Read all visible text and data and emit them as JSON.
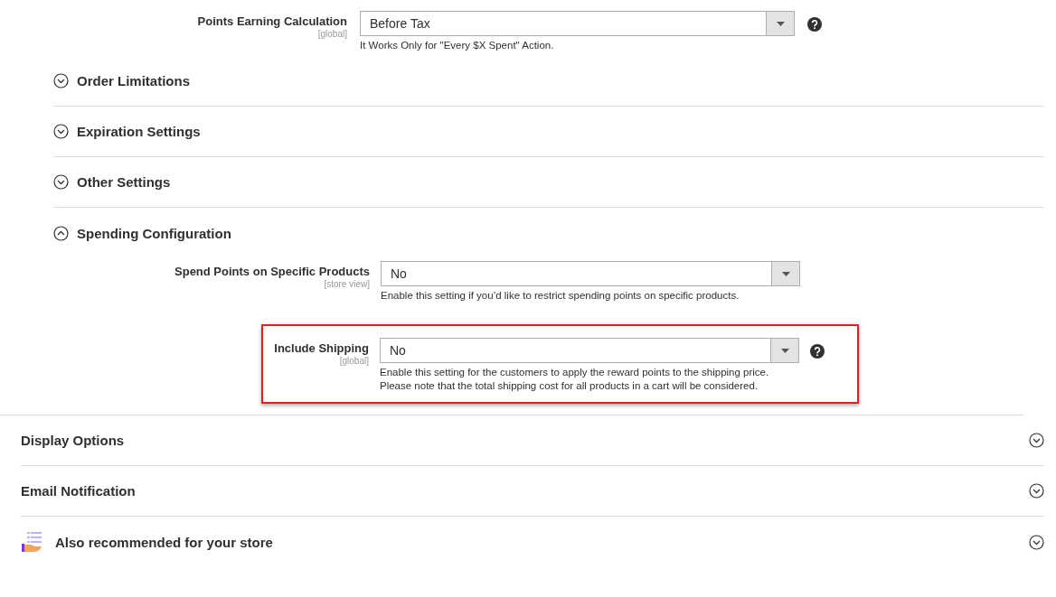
{
  "top_field": {
    "label": "Points Earning Calculation",
    "scope": "[global]",
    "value": "Before Tax",
    "note": "It Works Only for \"Every $X Spent\" Action.",
    "help": true
  },
  "subsections": [
    {
      "title": "Order Limitations",
      "expanded": false
    },
    {
      "title": "Expiration Settings",
      "expanded": false
    },
    {
      "title": "Other Settings",
      "expanded": false
    },
    {
      "title": "Spending Configuration",
      "expanded": true
    }
  ],
  "spending_fields": [
    {
      "label": "Spend Points on Specific Products",
      "scope": "[store view]",
      "value": "No",
      "note": "Enable this setting if you’d like to restrict spending points on specific products.",
      "help": false,
      "highlighted": false
    },
    {
      "label": "Include Shipping",
      "scope": "[global]",
      "value": "No",
      "note": "Enable this setting for the customers to apply the reward points to the shipping price. Please note that the total shipping cost for all products in a cart will be considered.",
      "help": true,
      "highlighted": true
    }
  ],
  "sections": [
    {
      "title": "Display Options",
      "kind": "plain",
      "expanded": false
    },
    {
      "title": "Email Notification",
      "kind": "plain",
      "expanded": false
    },
    {
      "title": "Also recommended for your store",
      "kind": "recommended",
      "expanded": false
    }
  ]
}
